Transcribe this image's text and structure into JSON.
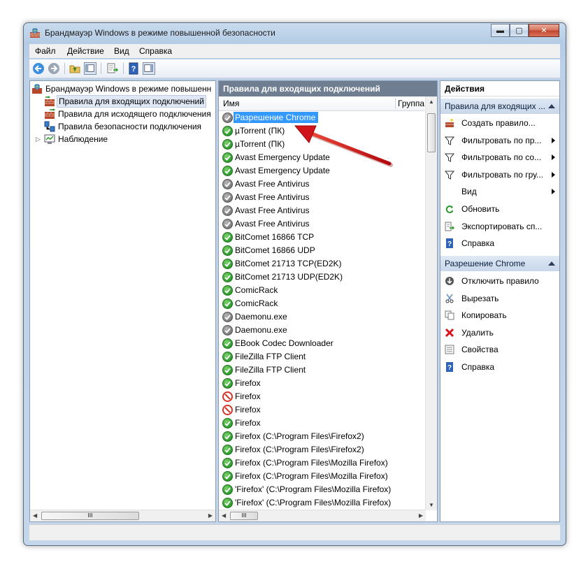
{
  "window": {
    "title": "Брандмауэр Windows в режиме повышенной безопасности",
    "controls": [
      "minimize",
      "maximize",
      "close"
    ]
  },
  "menu": [
    {
      "label": "Файл"
    },
    {
      "label": "Действие"
    },
    {
      "label": "Вид"
    },
    {
      "label": "Справка"
    }
  ],
  "toolbar": {
    "icons": [
      "back-icon",
      "forward-icon",
      "up-folder-icon",
      "show-hide-tree-icon",
      "export-list-icon",
      "help-icon",
      "show-hide-action-pane-icon"
    ]
  },
  "tree": {
    "root": "Брандмауэр Windows в режиме повышенн",
    "items": [
      {
        "label": "Правила для входящих подключений",
        "selected": true
      },
      {
        "label": "Правила для исходящего подключения"
      },
      {
        "label": "Правила безопасности подключения"
      },
      {
        "label": "Наблюдение",
        "expandable": true
      }
    ],
    "hscroll_label": "III"
  },
  "rules_pane": {
    "header": "Правила для входящих подключений",
    "columns": [
      "Имя",
      "Группа"
    ],
    "hscroll_label": "III",
    "rows": [
      {
        "name": "Разрешение Chrome",
        "status": "gray",
        "selected": true
      },
      {
        "name": "µTorrent (ПК)",
        "status": "green"
      },
      {
        "name": "µTorrent (ПК)",
        "status": "green"
      },
      {
        "name": "Avast Emergency Update",
        "status": "green"
      },
      {
        "name": "Avast Emergency Update",
        "status": "green"
      },
      {
        "name": "Avast Free Antivirus",
        "status": "gray"
      },
      {
        "name": "Avast Free Antivirus",
        "status": "gray"
      },
      {
        "name": "Avast Free Antivirus",
        "status": "gray"
      },
      {
        "name": "Avast Free Antivirus",
        "status": "gray"
      },
      {
        "name": "BitComet 16866 TCP",
        "status": "green"
      },
      {
        "name": "BitComet 16866 UDP",
        "status": "green"
      },
      {
        "name": "BitComet 21713 TCP(ED2K)",
        "status": "green"
      },
      {
        "name": "BitComet 21713 UDP(ED2K)",
        "status": "green"
      },
      {
        "name": "ComicRack",
        "status": "green"
      },
      {
        "name": "ComicRack",
        "status": "green"
      },
      {
        "name": "Daemonu.exe",
        "status": "gray"
      },
      {
        "name": "Daemonu.exe",
        "status": "gray"
      },
      {
        "name": "EBook Codec Downloader",
        "status": "green"
      },
      {
        "name": "FileZilla FTP Client",
        "status": "green"
      },
      {
        "name": "FileZilla FTP Client",
        "status": "green"
      },
      {
        "name": "Firefox",
        "status": "green"
      },
      {
        "name": "Firefox",
        "status": "block"
      },
      {
        "name": "Firefox",
        "status": "block"
      },
      {
        "name": "Firefox",
        "status": "green"
      },
      {
        "name": "Firefox (C:\\Program Files\\Firefox2)",
        "status": "green"
      },
      {
        "name": "Firefox (C:\\Program Files\\Firefox2)",
        "status": "green"
      },
      {
        "name": "Firefox (C:\\Program Files\\Mozilla Firefox)",
        "status": "green"
      },
      {
        "name": "Firefox (C:\\Program Files\\Mozilla Firefox)",
        "status": "green"
      },
      {
        "name": "'Firefox' (C:\\Program Files\\Mozilla Firefox)",
        "status": "green"
      },
      {
        "name": "'Firefox' (C:\\Program Files\\Mozilla Firefox)",
        "status": "green"
      }
    ]
  },
  "actions": {
    "title": "Действия",
    "section1": {
      "label": "Правила для входящих ...",
      "items": [
        {
          "label": "Создать правило...",
          "icon": "new-rule-icon"
        },
        {
          "label": "Фильтровать по пр...",
          "icon": "filter-icon",
          "submenu": true
        },
        {
          "label": "Фильтровать по со...",
          "icon": "filter-icon",
          "submenu": true
        },
        {
          "label": "Фильтровать по гру...",
          "icon": "filter-icon",
          "submenu": true
        },
        {
          "label": "Вид",
          "icon": "",
          "submenu": true
        },
        {
          "label": "Обновить",
          "icon": "refresh-icon"
        },
        {
          "label": "Экспортировать сп...",
          "icon": "export-icon"
        },
        {
          "label": "Справка",
          "icon": "help-icon"
        }
      ]
    },
    "section2": {
      "label": "Разрешение Chrome",
      "items": [
        {
          "label": "Отключить правило",
          "icon": "disable-icon"
        },
        {
          "label": "Вырезать",
          "icon": "cut-icon"
        },
        {
          "label": "Копировать",
          "icon": "copy-icon"
        },
        {
          "label": "Удалить",
          "icon": "delete-icon"
        },
        {
          "label": "Свойства",
          "icon": "properties-icon"
        },
        {
          "label": "Справка",
          "icon": "help-icon"
        }
      ]
    }
  },
  "colors": {
    "selection": "#3399ff",
    "pane_header": "#6f7f91",
    "annotation_arrow": "#d0141a"
  }
}
